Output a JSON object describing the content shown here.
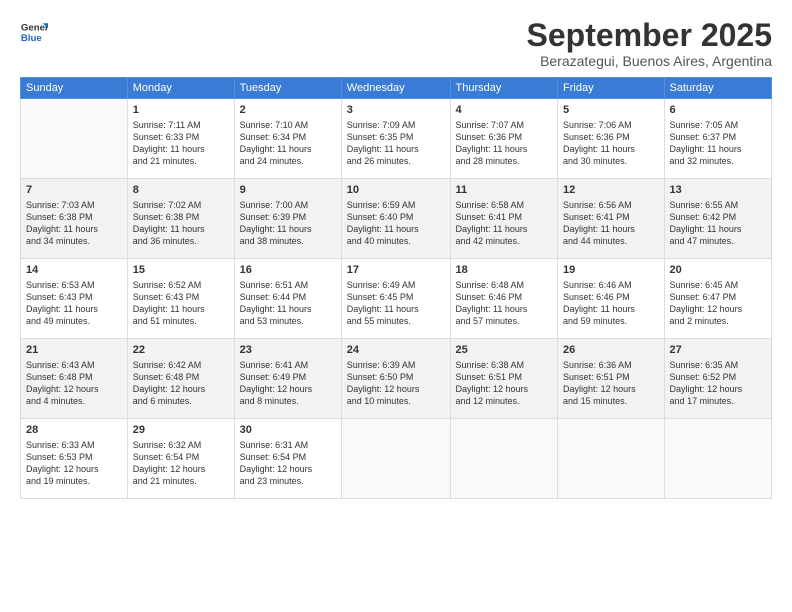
{
  "logo": {
    "general": "General",
    "blue": "Blue"
  },
  "title": "September 2025",
  "subtitle": "Berazategui, Buenos Aires, Argentina",
  "headers": [
    "Sunday",
    "Monday",
    "Tuesday",
    "Wednesday",
    "Thursday",
    "Friday",
    "Saturday"
  ],
  "weeks": [
    [
      {
        "day": "",
        "info": ""
      },
      {
        "day": "1",
        "info": "Sunrise: 7:11 AM\nSunset: 6:33 PM\nDaylight: 11 hours\nand 21 minutes."
      },
      {
        "day": "2",
        "info": "Sunrise: 7:10 AM\nSunset: 6:34 PM\nDaylight: 11 hours\nand 24 minutes."
      },
      {
        "day": "3",
        "info": "Sunrise: 7:09 AM\nSunset: 6:35 PM\nDaylight: 11 hours\nand 26 minutes."
      },
      {
        "day": "4",
        "info": "Sunrise: 7:07 AM\nSunset: 6:36 PM\nDaylight: 11 hours\nand 28 minutes."
      },
      {
        "day": "5",
        "info": "Sunrise: 7:06 AM\nSunset: 6:36 PM\nDaylight: 11 hours\nand 30 minutes."
      },
      {
        "day": "6",
        "info": "Sunrise: 7:05 AM\nSunset: 6:37 PM\nDaylight: 11 hours\nand 32 minutes."
      }
    ],
    [
      {
        "day": "7",
        "info": "Sunrise: 7:03 AM\nSunset: 6:38 PM\nDaylight: 11 hours\nand 34 minutes."
      },
      {
        "day": "8",
        "info": "Sunrise: 7:02 AM\nSunset: 6:38 PM\nDaylight: 11 hours\nand 36 minutes."
      },
      {
        "day": "9",
        "info": "Sunrise: 7:00 AM\nSunset: 6:39 PM\nDaylight: 11 hours\nand 38 minutes."
      },
      {
        "day": "10",
        "info": "Sunrise: 6:59 AM\nSunset: 6:40 PM\nDaylight: 11 hours\nand 40 minutes."
      },
      {
        "day": "11",
        "info": "Sunrise: 6:58 AM\nSunset: 6:41 PM\nDaylight: 11 hours\nand 42 minutes."
      },
      {
        "day": "12",
        "info": "Sunrise: 6:56 AM\nSunset: 6:41 PM\nDaylight: 11 hours\nand 44 minutes."
      },
      {
        "day": "13",
        "info": "Sunrise: 6:55 AM\nSunset: 6:42 PM\nDaylight: 11 hours\nand 47 minutes."
      }
    ],
    [
      {
        "day": "14",
        "info": "Sunrise: 6:53 AM\nSunset: 6:43 PM\nDaylight: 11 hours\nand 49 minutes."
      },
      {
        "day": "15",
        "info": "Sunrise: 6:52 AM\nSunset: 6:43 PM\nDaylight: 11 hours\nand 51 minutes."
      },
      {
        "day": "16",
        "info": "Sunrise: 6:51 AM\nSunset: 6:44 PM\nDaylight: 11 hours\nand 53 minutes."
      },
      {
        "day": "17",
        "info": "Sunrise: 6:49 AM\nSunset: 6:45 PM\nDaylight: 11 hours\nand 55 minutes."
      },
      {
        "day": "18",
        "info": "Sunrise: 6:48 AM\nSunset: 6:46 PM\nDaylight: 11 hours\nand 57 minutes."
      },
      {
        "day": "19",
        "info": "Sunrise: 6:46 AM\nSunset: 6:46 PM\nDaylight: 11 hours\nand 59 minutes."
      },
      {
        "day": "20",
        "info": "Sunrise: 6:45 AM\nSunset: 6:47 PM\nDaylight: 12 hours\nand 2 minutes."
      }
    ],
    [
      {
        "day": "21",
        "info": "Sunrise: 6:43 AM\nSunset: 6:48 PM\nDaylight: 12 hours\nand 4 minutes."
      },
      {
        "day": "22",
        "info": "Sunrise: 6:42 AM\nSunset: 6:48 PM\nDaylight: 12 hours\nand 6 minutes."
      },
      {
        "day": "23",
        "info": "Sunrise: 6:41 AM\nSunset: 6:49 PM\nDaylight: 12 hours\nand 8 minutes."
      },
      {
        "day": "24",
        "info": "Sunrise: 6:39 AM\nSunset: 6:50 PM\nDaylight: 12 hours\nand 10 minutes."
      },
      {
        "day": "25",
        "info": "Sunrise: 6:38 AM\nSunset: 6:51 PM\nDaylight: 12 hours\nand 12 minutes."
      },
      {
        "day": "26",
        "info": "Sunrise: 6:36 AM\nSunset: 6:51 PM\nDaylight: 12 hours\nand 15 minutes."
      },
      {
        "day": "27",
        "info": "Sunrise: 6:35 AM\nSunset: 6:52 PM\nDaylight: 12 hours\nand 17 minutes."
      }
    ],
    [
      {
        "day": "28",
        "info": "Sunrise: 6:33 AM\nSunset: 6:53 PM\nDaylight: 12 hours\nand 19 minutes."
      },
      {
        "day": "29",
        "info": "Sunrise: 6:32 AM\nSunset: 6:54 PM\nDaylight: 12 hours\nand 21 minutes."
      },
      {
        "day": "30",
        "info": "Sunrise: 6:31 AM\nSunset: 6:54 PM\nDaylight: 12 hours\nand 23 minutes."
      },
      {
        "day": "",
        "info": ""
      },
      {
        "day": "",
        "info": ""
      },
      {
        "day": "",
        "info": ""
      },
      {
        "day": "",
        "info": ""
      }
    ]
  ]
}
